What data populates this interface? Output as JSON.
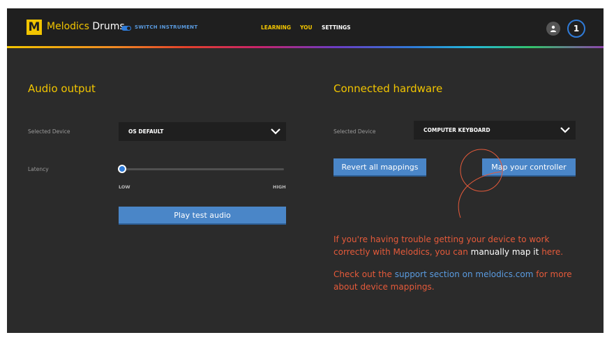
{
  "app": {
    "logo_letter": "M",
    "brand_name": "Melodics",
    "brand_instrument": "Drums",
    "switch_label": "SWITCH INSTRUMENT",
    "level": "1"
  },
  "nav": {
    "learning": "LEARNING",
    "you": "YOU",
    "settings": "SETTINGS"
  },
  "audio": {
    "title": "Audio output",
    "device_label": "Selected Device",
    "device_value": "OS DEFAULT",
    "latency_label": "Latency",
    "latency_low": "LOW",
    "latency_high": "HIGH",
    "latency_level": 0.02,
    "test_button": "Play test audio"
  },
  "hardware": {
    "title": "Connected hardware",
    "device_label": "Selected Device",
    "device_value": "COMPUTER KEYBOARD",
    "revert_button": "Revert all mappings",
    "map_button": "Map your controller",
    "msg1_a": "If you're having trouble getting your device to work correctly with Melodics, you can",
    "msg1_link": "manually map it",
    "msg1_b": "here.",
    "msg2_a": "Check out the",
    "msg2_link": "support section on melodics.com",
    "msg2_b": "for more about device mappings."
  },
  "colors": {
    "accent_yellow": "#f2c500",
    "button_blue": "#4a86c8",
    "message_orange": "#e55a3a",
    "link_blue": "#5a9be0",
    "background": "#2b2b2b"
  },
  "icons": [
    "profile-icon",
    "chevron-down-icon",
    "toggle-switch-icon"
  ]
}
